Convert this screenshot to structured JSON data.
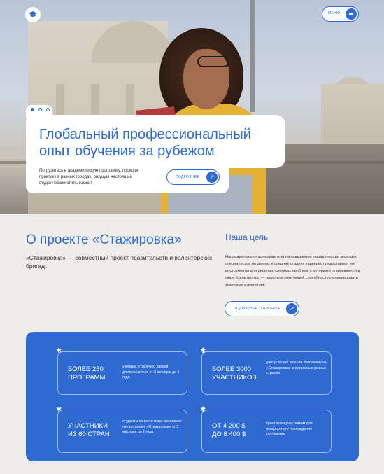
{
  "header": {
    "logo_icon": "graduation-cap-icon",
    "menu_label": "МЕНЮ",
    "menu_icon": "hamburger-icon"
  },
  "hero": {
    "title_line1": "Глобальный профессиональный",
    "title_line2": "опыт обучения за рубежом",
    "description": "Погрузитесь в академическую программу, проходя практику в разных городах, ощущая настоящий студенческий стиль жизни!",
    "more_label": "ПОДРОБНЕЕ",
    "more_icon": "arrow-up-right-icon",
    "slider_dots": 3,
    "active_dot": 1
  },
  "about": {
    "title": "О проекте «Стажировка»",
    "text": "«Стажировка» — совместный проект правительств и волонтёрских бригад."
  },
  "goal": {
    "title": "Наша цель",
    "text": "Наша деятельность направлена на повышение квалификации молодых специалистов на ранних и средних стадиях карьеры, предоставляя им инструменты для решения сложных проблем, с которыми сталкиваются в мире. Цель центра — наделить этих людей способностью инициировать значимые изменения.",
    "more_label": "ПОДРОБНЕЕ О ПРОЕКТЕ",
    "more_icon": "arrow-up-right-icon"
  },
  "stats": [
    {
      "big_line1": "БОЛЕЕ 250",
      "big_line2": "ПРОГРАММ",
      "small": "учебных и рабочих, разной длительностью от 3 месяцев до 1 года"
    },
    {
      "big_line1": "БОЛЕЕ 3000",
      "big_line2": "УЧАСТНИКОВ",
      "small": "уже успешно прошли программу от «Стажировка» и остались в разных странах"
    },
    {
      "big_line1": "УЧАСТНИКИ",
      "big_line2": "ИЗ 60 СТРАН",
      "small": "студенты со всего мира приезжают на программу «Стажировки» от 3 месяцев до 1 года"
    },
    {
      "big_line1": "ОТ 4 200 $",
      "big_line2": "ДО 8 400 $",
      "small": "грант всем участникам для комфортного прохождения программы"
    }
  ],
  "colors": {
    "accent": "#2e6ad1",
    "background": "#efede9"
  }
}
